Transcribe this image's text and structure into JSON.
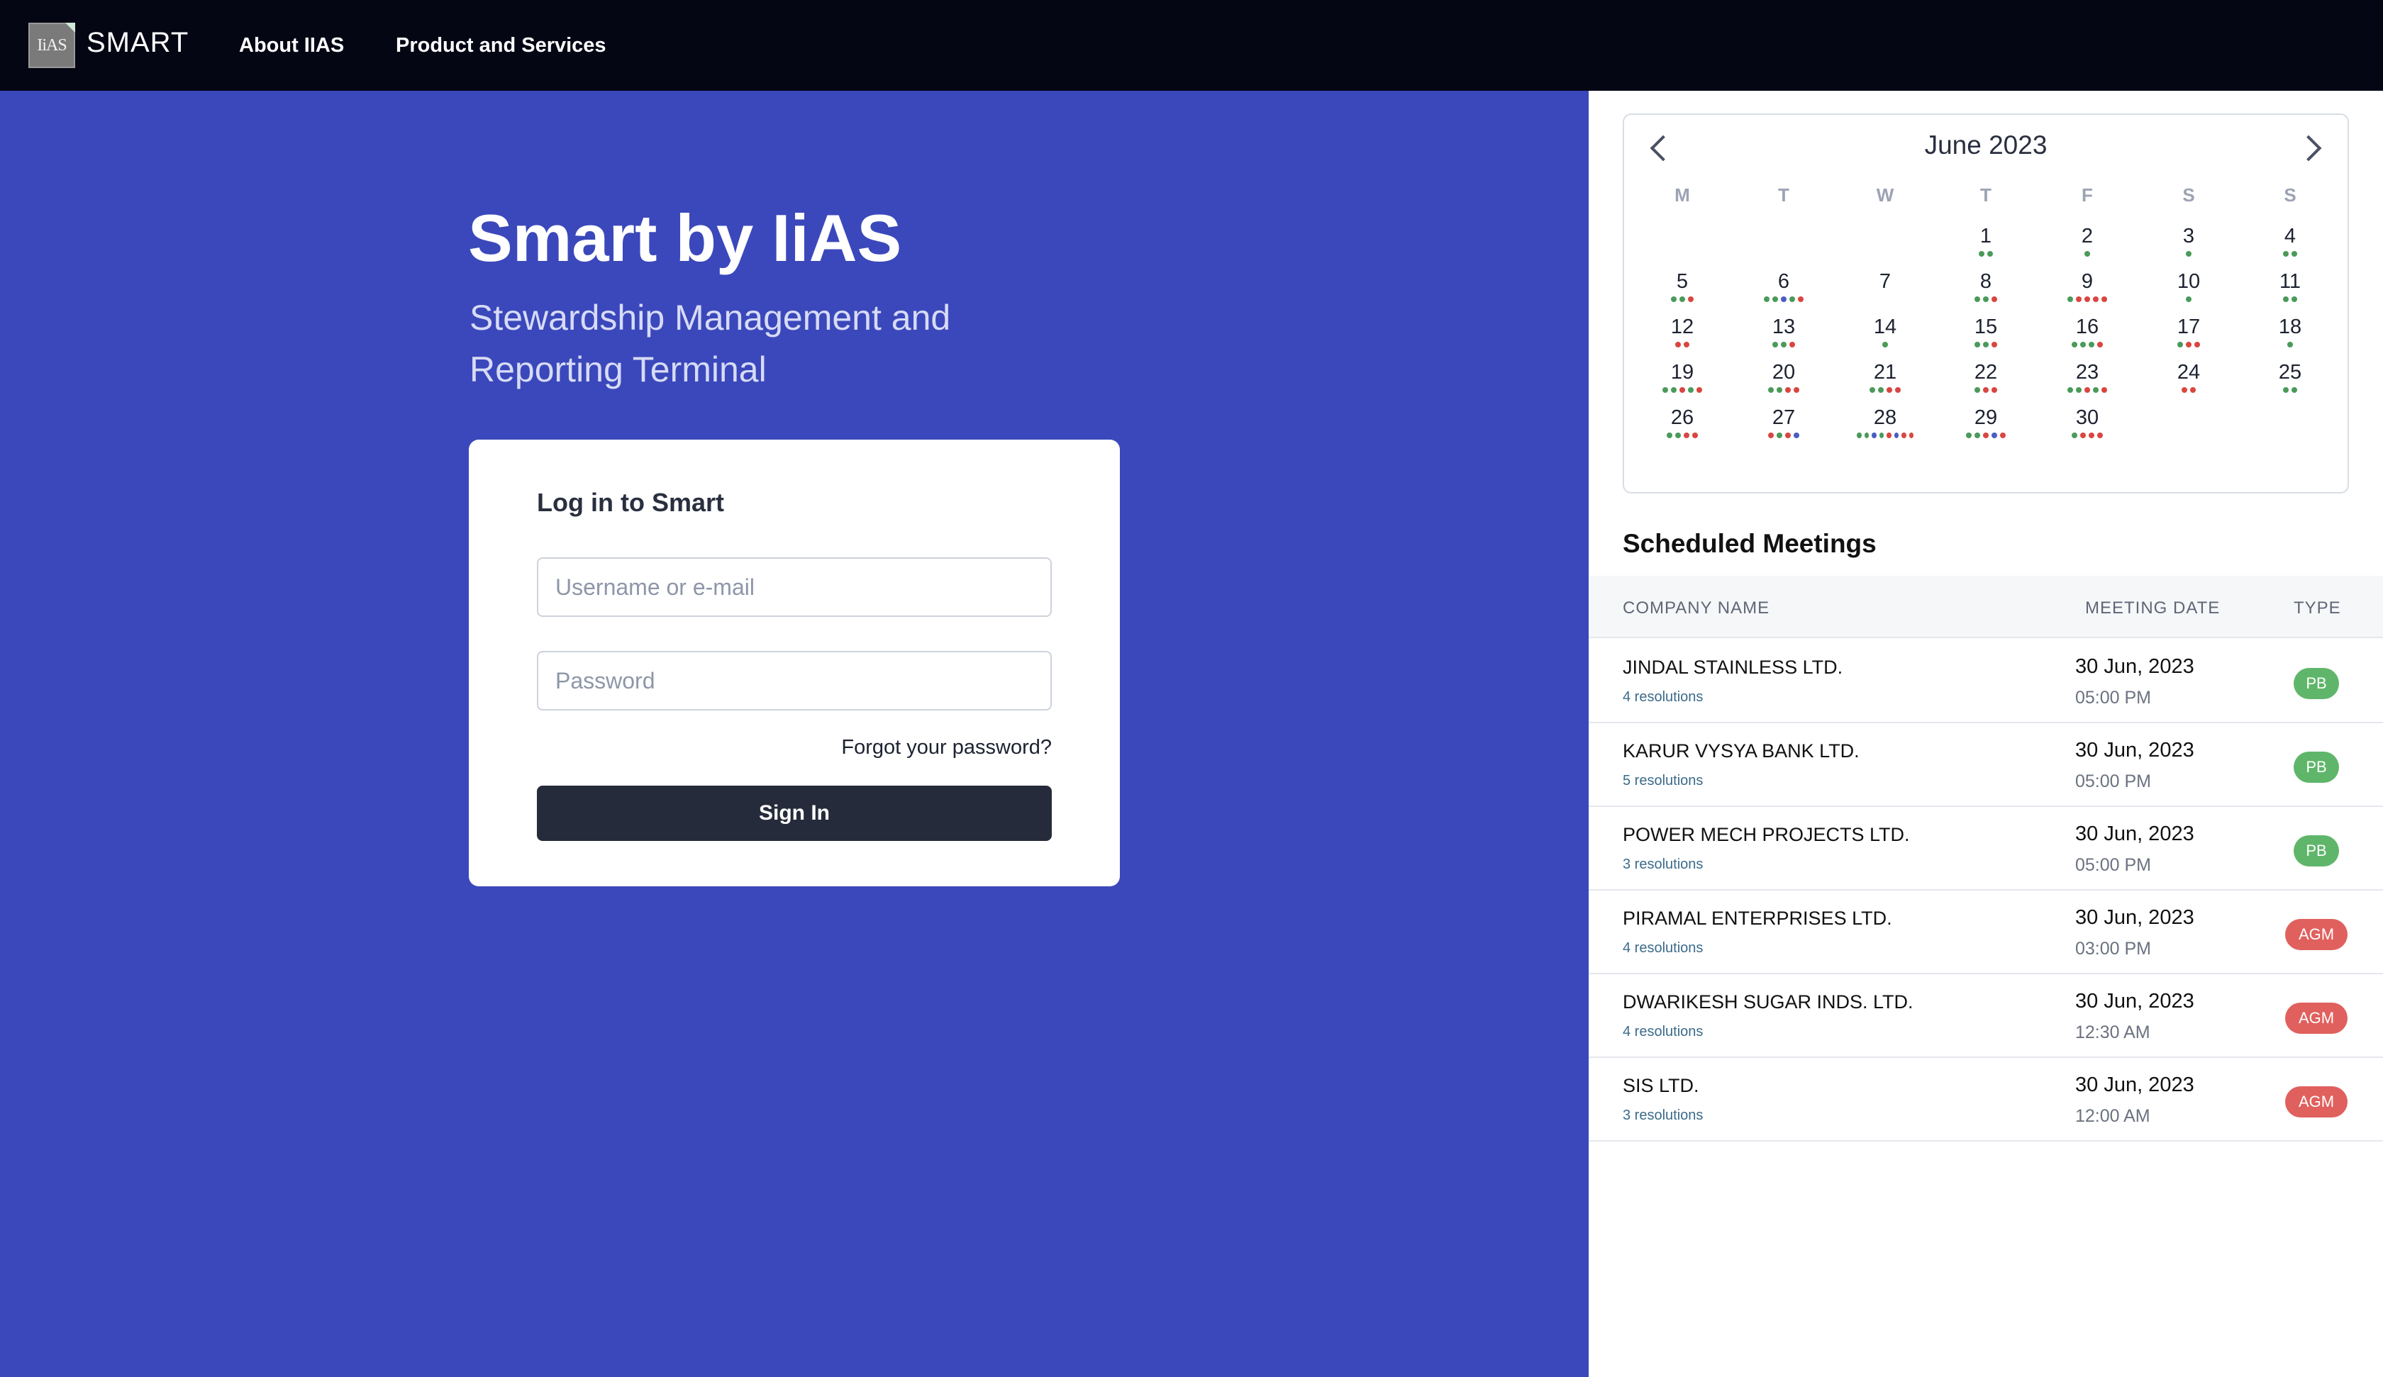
{
  "nav": {
    "logo_text": "IiAS",
    "brand": "SMART",
    "links": [
      "About IIAS",
      "Product and Services"
    ]
  },
  "hero": {
    "title": "Smart by IiAS",
    "subtitle_line1": "Stewardship Management and",
    "subtitle_line2": "Reporting Terminal"
  },
  "login": {
    "title": "Log in to Smart",
    "username_placeholder": "Username or e-mail",
    "password_placeholder": "Password",
    "forgot": "Forgot your password?",
    "signin": "Sign In"
  },
  "calendar": {
    "month": "June 2023",
    "weekdays": [
      "M",
      "T",
      "W",
      "T",
      "F",
      "S",
      "S"
    ],
    "dot_colors": {
      "g": "#4a9a5a",
      "r": "#d9463f",
      "b": "#4a5ec2"
    },
    "days": [
      {
        "d": "1",
        "col": 3,
        "row": 0,
        "dots": [
          "g",
          "g"
        ]
      },
      {
        "d": "2",
        "col": 4,
        "row": 0,
        "dots": [
          "g"
        ]
      },
      {
        "d": "3",
        "col": 5,
        "row": 0,
        "dots": [
          "g"
        ]
      },
      {
        "d": "4",
        "col": 6,
        "row": 0,
        "dots": [
          "g",
          "g"
        ]
      },
      {
        "d": "5",
        "col": 0,
        "row": 1,
        "dots": [
          "g",
          "g",
          "r"
        ]
      },
      {
        "d": "6",
        "col": 1,
        "row": 1,
        "dots": [
          "g",
          "g",
          "b",
          "g",
          "r"
        ]
      },
      {
        "d": "7",
        "col": 2,
        "row": 1,
        "dots": []
      },
      {
        "d": "8",
        "col": 3,
        "row": 1,
        "dots": [
          "g",
          "g",
          "r"
        ]
      },
      {
        "d": "9",
        "col": 4,
        "row": 1,
        "dots": [
          "g",
          "r",
          "r",
          "r",
          "r"
        ]
      },
      {
        "d": "10",
        "col": 5,
        "row": 1,
        "dots": [
          "g"
        ]
      },
      {
        "d": "11",
        "col": 6,
        "row": 1,
        "dots": [
          "g",
          "g"
        ]
      },
      {
        "d": "12",
        "col": 0,
        "row": 2,
        "dots": [
          "r",
          "r"
        ]
      },
      {
        "d": "13",
        "col": 1,
        "row": 2,
        "dots": [
          "g",
          "g",
          "r"
        ]
      },
      {
        "d": "14",
        "col": 2,
        "row": 2,
        "dots": [
          "g"
        ]
      },
      {
        "d": "15",
        "col": 3,
        "row": 2,
        "dots": [
          "g",
          "g",
          "r"
        ]
      },
      {
        "d": "16",
        "col": 4,
        "row": 2,
        "dots": [
          "g",
          "g",
          "g",
          "r"
        ]
      },
      {
        "d": "17",
        "col": 5,
        "row": 2,
        "dots": [
          "g",
          "r",
          "r"
        ]
      },
      {
        "d": "18",
        "col": 6,
        "row": 2,
        "dots": [
          "g"
        ]
      },
      {
        "d": "19",
        "col": 0,
        "row": 3,
        "dots": [
          "g",
          "g",
          "r",
          "g",
          "r"
        ]
      },
      {
        "d": "20",
        "col": 1,
        "row": 3,
        "dots": [
          "g",
          "g",
          "r",
          "r"
        ]
      },
      {
        "d": "21",
        "col": 2,
        "row": 3,
        "dots": [
          "g",
          "g",
          "r",
          "r"
        ]
      },
      {
        "d": "22",
        "col": 3,
        "row": 3,
        "dots": [
          "g",
          "r",
          "r"
        ]
      },
      {
        "d": "23",
        "col": 4,
        "row": 3,
        "dots": [
          "g",
          "g",
          "r",
          "g",
          "r"
        ]
      },
      {
        "d": "24",
        "col": 5,
        "row": 3,
        "dots": [
          "r",
          "r"
        ]
      },
      {
        "d": "25",
        "col": 6,
        "row": 3,
        "dots": [
          "g",
          "g"
        ]
      },
      {
        "d": "26",
        "col": 0,
        "row": 4,
        "dots": [
          "g",
          "g",
          "r",
          "r"
        ]
      },
      {
        "d": "27",
        "col": 1,
        "row": 4,
        "dots": [
          "r",
          "g",
          "r",
          "b"
        ]
      },
      {
        "d": "28",
        "col": 2,
        "row": 4,
        "dots": [
          "g",
          "g",
          "b",
          "g",
          "r",
          "b",
          "r",
          "r"
        ]
      },
      {
        "d": "29",
        "col": 3,
        "row": 4,
        "dots": [
          "g",
          "g",
          "r",
          "b",
          "r"
        ]
      },
      {
        "d": "30",
        "col": 4,
        "row": 4,
        "dots": [
          "g",
          "r",
          "r",
          "r"
        ]
      }
    ]
  },
  "meetings": {
    "title": "Scheduled Meetings",
    "columns": [
      "COMPANY NAME",
      "MEETING DATE",
      "TYPE"
    ],
    "rows": [
      {
        "company": "JINDAL STAINLESS LTD.",
        "resolutions": "4 resolutions",
        "date": "30 Jun, 2023",
        "time": "05:00 PM",
        "type": "PB"
      },
      {
        "company": "KARUR VYSYA BANK LTD.",
        "resolutions": "5 resolutions",
        "date": "30 Jun, 2023",
        "time": "05:00 PM",
        "type": "PB"
      },
      {
        "company": "POWER MECH PROJECTS LTD.",
        "resolutions": "3 resolutions",
        "date": "30 Jun, 2023",
        "time": "05:00 PM",
        "type": "PB"
      },
      {
        "company": "PIRAMAL ENTERPRISES LTD.",
        "resolutions": "4 resolutions",
        "date": "30 Jun, 2023",
        "time": "03:00 PM",
        "type": "AGM"
      },
      {
        "company": "DWARIKESH SUGAR INDS. LTD.",
        "resolutions": "4 resolutions",
        "date": "30 Jun, 2023",
        "time": "12:30 AM",
        "type": "AGM"
      },
      {
        "company": "SIS LTD.",
        "resolutions": "3 resolutions",
        "date": "30 Jun, 2023",
        "time": "12:00 AM",
        "type": "AGM"
      }
    ]
  }
}
